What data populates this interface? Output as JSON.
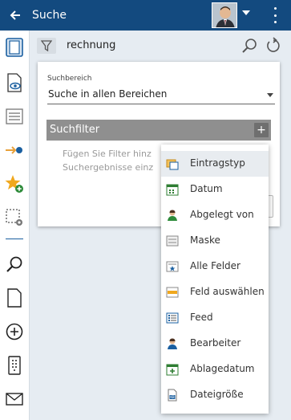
{
  "header": {
    "back_icon": "arrow-left-icon",
    "title": "Suche",
    "avatar_icon": "user-avatar",
    "menu_icon": "more-vertical-icon"
  },
  "rail": {
    "items": [
      {
        "icon": "document-outline-icon"
      },
      {
        "icon": "document-eye-icon"
      },
      {
        "icon": "list-icon"
      },
      {
        "icon": "arrow-to-dot-icon"
      },
      {
        "icon": "star-add-icon"
      },
      {
        "icon": "selection-gear-icon"
      },
      {
        "icon": "search-icon"
      },
      {
        "icon": "new-document-icon"
      },
      {
        "icon": "plus-circle-icon"
      },
      {
        "icon": "dotted-document-icon"
      },
      {
        "icon": "mail-icon"
      }
    ],
    "accent": "#1a5fa0"
  },
  "search": {
    "value": "rechnung",
    "filter_icon": "funnel-icon",
    "go_icon": "search-icon",
    "reset_icon": "reset-icon"
  },
  "panel": {
    "scope_label": "Suchbereich",
    "scope_value": "Suche in allen Bereichen",
    "filter_title": "Suchfilter",
    "filter_add": "+",
    "hint_line1": "Fügen Sie Filter hinz",
    "hint_line2": "Suchergebnisse einz"
  },
  "menu": {
    "items": [
      {
        "label": "Eintragstyp",
        "icon": "entry-type-icon",
        "active": true
      },
      {
        "label": "Datum",
        "icon": "calendar-icon",
        "active": false
      },
      {
        "label": "Abgelegt von",
        "icon": "person-icon",
        "active": false
      },
      {
        "label": "Maske",
        "icon": "mask-icon",
        "active": false
      },
      {
        "label": "Alle Felder",
        "icon": "all-fields-icon",
        "active": false
      },
      {
        "label": "Feld auswählen",
        "icon": "field-select-icon",
        "active": false
      },
      {
        "label": "Feed",
        "icon": "feed-icon",
        "active": false
      },
      {
        "label": "Bearbeiter",
        "icon": "editor-person-icon",
        "active": false
      },
      {
        "label": "Ablagedatum",
        "icon": "calendar-plus-icon",
        "active": false
      },
      {
        "label": "Dateigröße",
        "icon": "file-size-icon",
        "active": false
      }
    ]
  },
  "colors": {
    "header_bg": "#134a7f",
    "filter_header_bg": "#8f8f8f",
    "menu_active_bg": "#e8ecf0"
  }
}
